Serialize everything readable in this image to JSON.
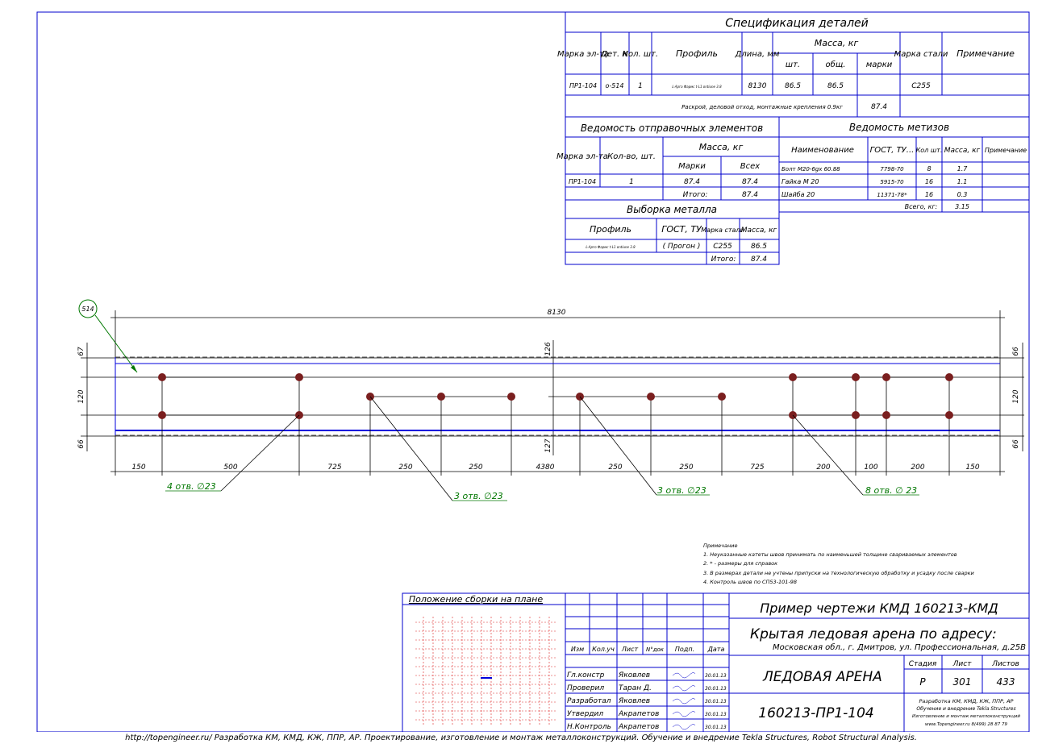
{
  "colors": {
    "frame": "#0000cc",
    "dimension": "#000000",
    "leader": "#007700",
    "bolt": "#7a1f1f",
    "plan_grid": "#dd2222",
    "beam_edge": "#0000dd",
    "dashed": "#555555"
  },
  "spec": {
    "title": "Спецификация деталей",
    "h_mark": "Марка эл-та",
    "h_det": "Дет. N",
    "h_qty": "Кол. шт.",
    "h_profile": "Профиль",
    "h_length": "Длина, мм",
    "h_mass": "Масса, кг",
    "h_mass_pcs": "шт.",
    "h_mass_total": "общ.",
    "h_mass_mark": "марки",
    "h_steel": "Марка стали",
    "h_note": "Примечание",
    "row": {
      "mark": "ПР1-104",
      "det": "о-514",
      "qty": "1",
      "profile": "L-Арго Фармс t-L1 ontiune 3.8",
      "length": "8130",
      "mass_pcs": "86.5",
      "mass_total": "86.5",
      "mass_mark": "",
      "steel": "С255",
      "note": ""
    },
    "summary_text": "Раскрой, деловой отход, монтажные крепления 0.9кг",
    "summary_value": "87.4"
  },
  "shipping": {
    "title": "Ведомость отправочных элементов",
    "h_mark": "Марка эл-та",
    "h_qty": "Кол-во, шт.",
    "h_mass": "Масса, кг",
    "h_mass_mark": "Марки",
    "h_mass_all": "Всех",
    "row": {
      "mark": "ПР1-104",
      "qty": "1",
      "mass_mark": "87.4",
      "mass_all": "87.4"
    },
    "total_label": "Итого:",
    "total_value": "87.4"
  },
  "hardware": {
    "title": "Ведомость метизов",
    "h_name": "Наименование",
    "h_gost": "ГОСТ, ТУ...",
    "h_qty": "Кол шт.",
    "h_mass": "Масса, кг",
    "h_note": "Примечание",
    "rows": [
      {
        "name": "Болт М20-6gх 60.88",
        "gost": "7798-70",
        "qty": "8",
        "mass": "1.7"
      },
      {
        "name": "Гайка М 20",
        "gost": "5915-70",
        "qty": "16",
        "mass": "1.1"
      },
      {
        "name": "Шайба 20",
        "gost": "11371-78*",
        "qty": "16",
        "mass": "0.3"
      }
    ],
    "total_label": "Всего, кг:",
    "total_value": "3.15"
  },
  "metal": {
    "title": "Выборка металла",
    "h_profile": "Профиль",
    "h_gost": "ГОСТ, ТУ",
    "h_steel": "Марка стали",
    "h_mass": "Масса, кг",
    "row": {
      "profile": "L-Арго Фармс t-L1 ontiune 3.8",
      "gost": "( Прогон )",
      "steel": "С255",
      "mass": "86.5"
    },
    "total_label": "Итого:",
    "total_value": "87.4"
  },
  "beam": {
    "part_number": "514",
    "overall_length": "8130",
    "left_dims": [
      "67",
      "120",
      "66"
    ],
    "right_dims": [
      "66",
      "120",
      "66"
    ],
    "center_top": "126",
    "center_bottom": "127",
    "bottom_dims": [
      "150",
      "500",
      "725",
      "250",
      "250",
      "4380",
      "250",
      "250",
      "725",
      "200",
      "100",
      "200",
      "150"
    ],
    "callouts": [
      {
        "text": "4 отв. ∅23"
      },
      {
        "text": "3 отв. ∅23"
      },
      {
        "text": "3 отв. ∅23"
      },
      {
        "text": "8 отв. ∅ 23"
      }
    ]
  },
  "notes": {
    "title": "Примечание",
    "lines": [
      "1. Неуказанные катеты швов принимать по наименьшей толщине свариваемых элементов",
      "2. * - размеры для справок",
      "3. В размерах детали не учтены припуски на технологическую обработку и усадку после сварки",
      "4. Контроль швов по СП53-101-98"
    ]
  },
  "titleblock": {
    "plan_title": "Положение сборки на плане",
    "h_izm": "Изм",
    "h_kol": "Кол.уч",
    "h_list": "Лист",
    "h_ndok": "N°док",
    "h_podp": "Подп.",
    "h_date": "Дата",
    "roles": [
      {
        "role": "Гл.констр",
        "name": "Яковлев",
        "date": "30.01.13"
      },
      {
        "role": "Проверил",
        "name": "Таран Д.",
        "date": "30.01.13"
      },
      {
        "role": "Разработал",
        "name": "Яковлев",
        "date": "30.01.13"
      },
      {
        "role": "Утвердил",
        "name": "Акрапетов",
        "date": "30.01.13"
      },
      {
        "role": "Н.Контроль",
        "name": "Акрапетов",
        "date": "30.01.13"
      }
    ],
    "project_code": "Пример чертежи КМД  160213-КМД",
    "project_name": "Крытая ледовая арена по адресу:",
    "address": "Московская обл., г. Дмитров, ул. Профессиональная, д.25В",
    "object": "ЛЕДОВАЯ АРЕНА",
    "h_stage": "Стадия",
    "h_sheet": "Лист",
    "h_sheets": "Листов",
    "stage": "Р",
    "sheet": "301",
    "sheets": "433",
    "drawing_number": "160213-ПР1-104",
    "company_lines": [
      "Разработка КМ, КМД, КЖ, ППР, АР",
      "Обучение  и внедрение Tekla Structures",
      "Изготовление и монтаж металлоконструкций",
      "www.Topengineer.ru        8(499) 28 87 79"
    ]
  },
  "footer": "http://topengineer.ru/  Разработка КМ, КМД, КЖ, ППР, АР. Проектирование, изготовление и монтаж металлоконструкций. Обучение и внедрение Tekla Structures, Robot Structural Analysis."
}
